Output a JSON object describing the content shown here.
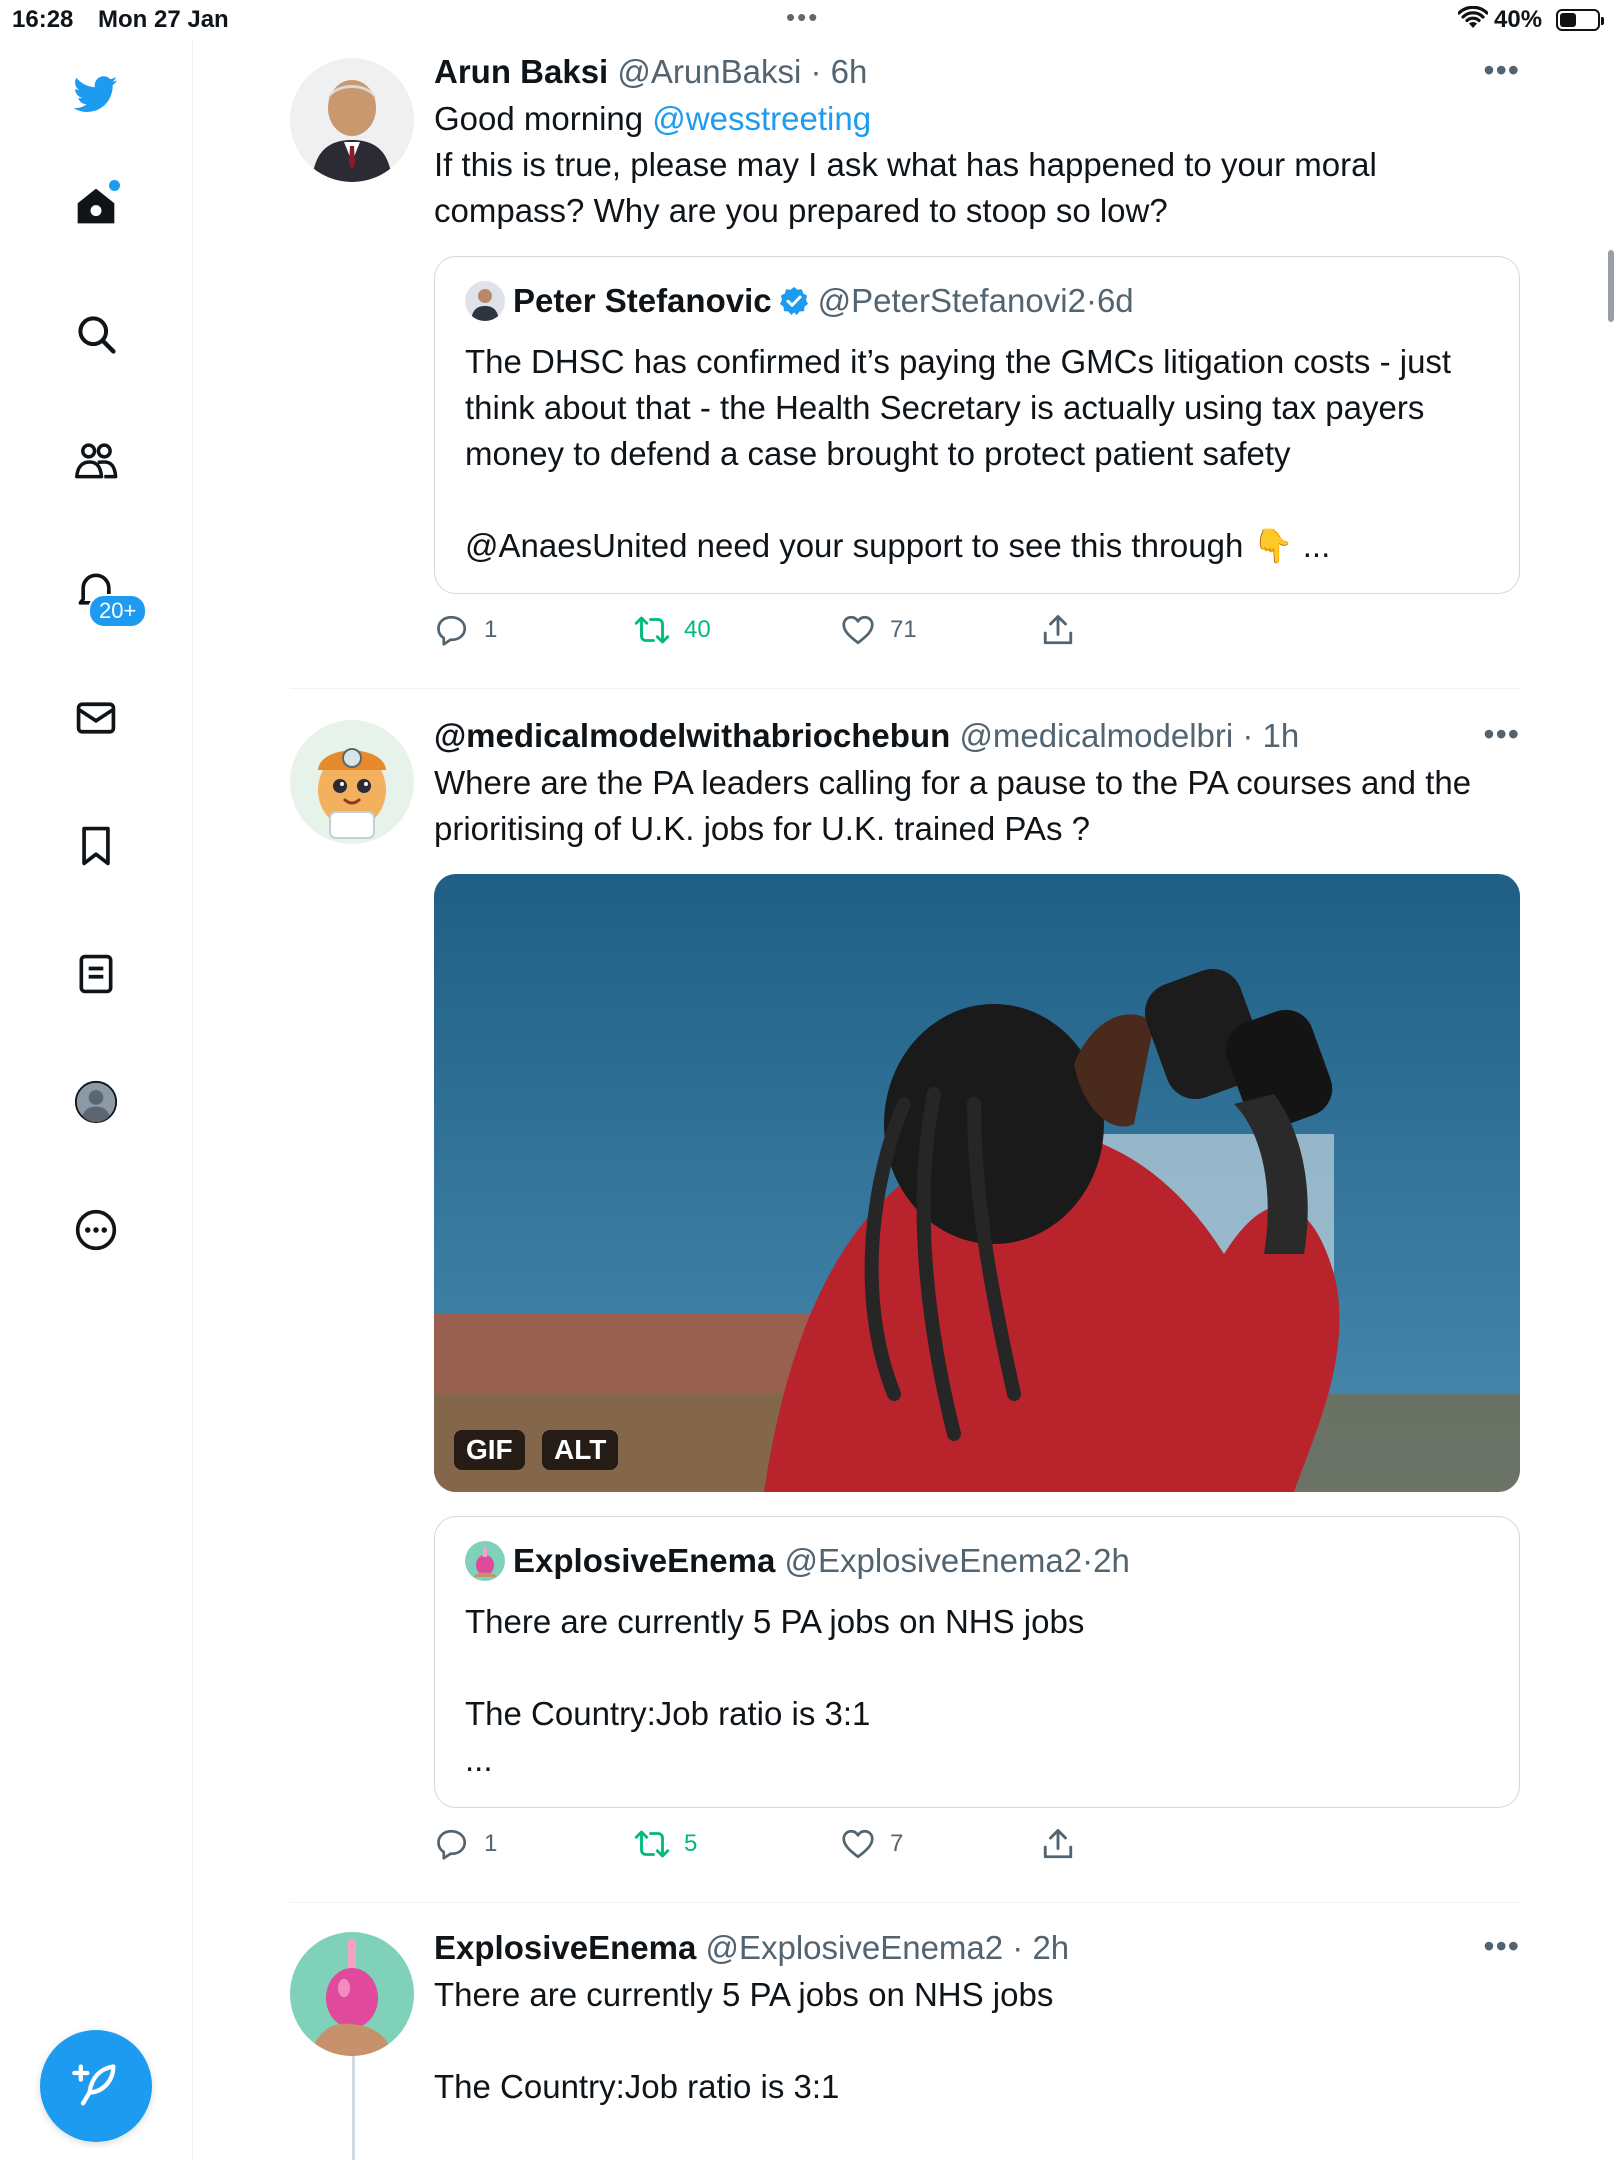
{
  "status_bar": {
    "time": "16:28",
    "date": "Mon 27 Jan",
    "battery": "40%"
  },
  "sidebar": {
    "notifications_badge": "20+",
    "items": [
      {
        "icon": "twitter-bird-icon"
      },
      {
        "icon": "home-icon"
      },
      {
        "icon": "search-icon"
      },
      {
        "icon": "communities-icon"
      },
      {
        "icon": "notifications-icon"
      },
      {
        "icon": "messages-icon"
      },
      {
        "icon": "bookmarks-icon"
      },
      {
        "icon": "lists-icon"
      },
      {
        "icon": "profile-icon"
      },
      {
        "icon": "more-icon"
      }
    ]
  },
  "tweets": [
    {
      "display_name": "Arun Baksi",
      "handle": "@ArunBaksi",
      "time": "6h",
      "text_prefix": "Good morning ",
      "mention": "@wesstreeting",
      "text_rest": "If this is true, please may I ask what has happened to your moral compass? Why are you prepared to stoop so low?",
      "quote": {
        "display_name": "Peter Stefanovic",
        "handle": "@PeterStefanovi2",
        "time": "6d",
        "text_line1": "The DHSC has confirmed it’s paying the GMCs litigation costs - just think about that - the Health Secretary is actually using tax payers money to defend a case brought to protect patient safety",
        "text_line2": "@AnaesUnited need your support to see this through 👇 ..."
      },
      "replies": "1",
      "retweets": "40",
      "likes": "71"
    },
    {
      "display_name": "@medicalmodelwithabriochebun",
      "handle": "@medicalmodelbri",
      "time": "1h",
      "text": "Where are the PA leaders calling for a pause to the PA courses and the prioritising of U.K. jobs for U.K. trained PAs ?",
      "media": {
        "gif_label": "GIF",
        "alt_label": "ALT"
      },
      "quote": {
        "display_name": "ExplosiveEnema",
        "handle": "@ExplosiveEnema2",
        "time": "2h",
        "text_line1": "There are currently 5 PA jobs on NHS jobs",
        "text_line2": "The Country:Job ratio is 3:1",
        "text_line3": "..."
      },
      "replies": "1",
      "retweets": "5",
      "likes": "7"
    },
    {
      "display_name": "ExplosiveEnema",
      "handle": "@ExplosiveEnema2",
      "time": "2h",
      "text_line1": "There are currently 5 PA jobs on NHS jobs",
      "text_line2": "The Country:Job ratio is 3:1"
    }
  ],
  "colors": {
    "accent": "#1d9bf0",
    "retweet": "#00ba7c",
    "secondary_text": "#536471",
    "border": "#cfd9de"
  }
}
